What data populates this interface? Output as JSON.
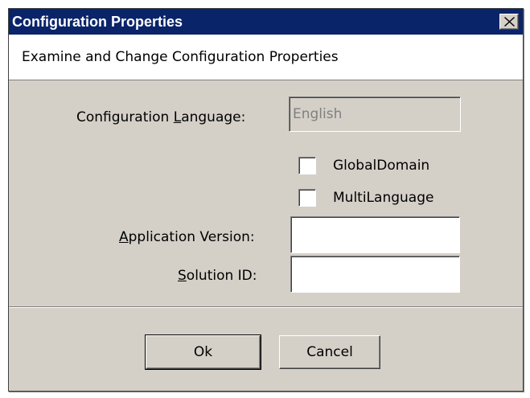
{
  "window": {
    "title": "Configuration Properties",
    "colors": {
      "title_bar": "#0a246a",
      "dialog_bg": "#d4d0c8",
      "header_bg": "#ffffff"
    }
  },
  "header": {
    "description": "Examine and Change Configuration Properties"
  },
  "form": {
    "language": {
      "label_pre": "Configuration ",
      "label_key": "L",
      "label_post": "anguage:",
      "value": "English"
    },
    "global_domain": {
      "label": "GlobalDomain",
      "checked": false
    },
    "multi_language": {
      "label": "MultiLanguage",
      "checked": false
    },
    "app_version": {
      "label_key": "A",
      "label_post": "pplication Version:",
      "value": ""
    },
    "solution_id": {
      "label_key": "S",
      "label_post": "olution ID:",
      "value": ""
    }
  },
  "buttons": {
    "ok_label": "Ok",
    "cancel_label": "Cancel"
  },
  "icons": {
    "close": "close-icon"
  }
}
